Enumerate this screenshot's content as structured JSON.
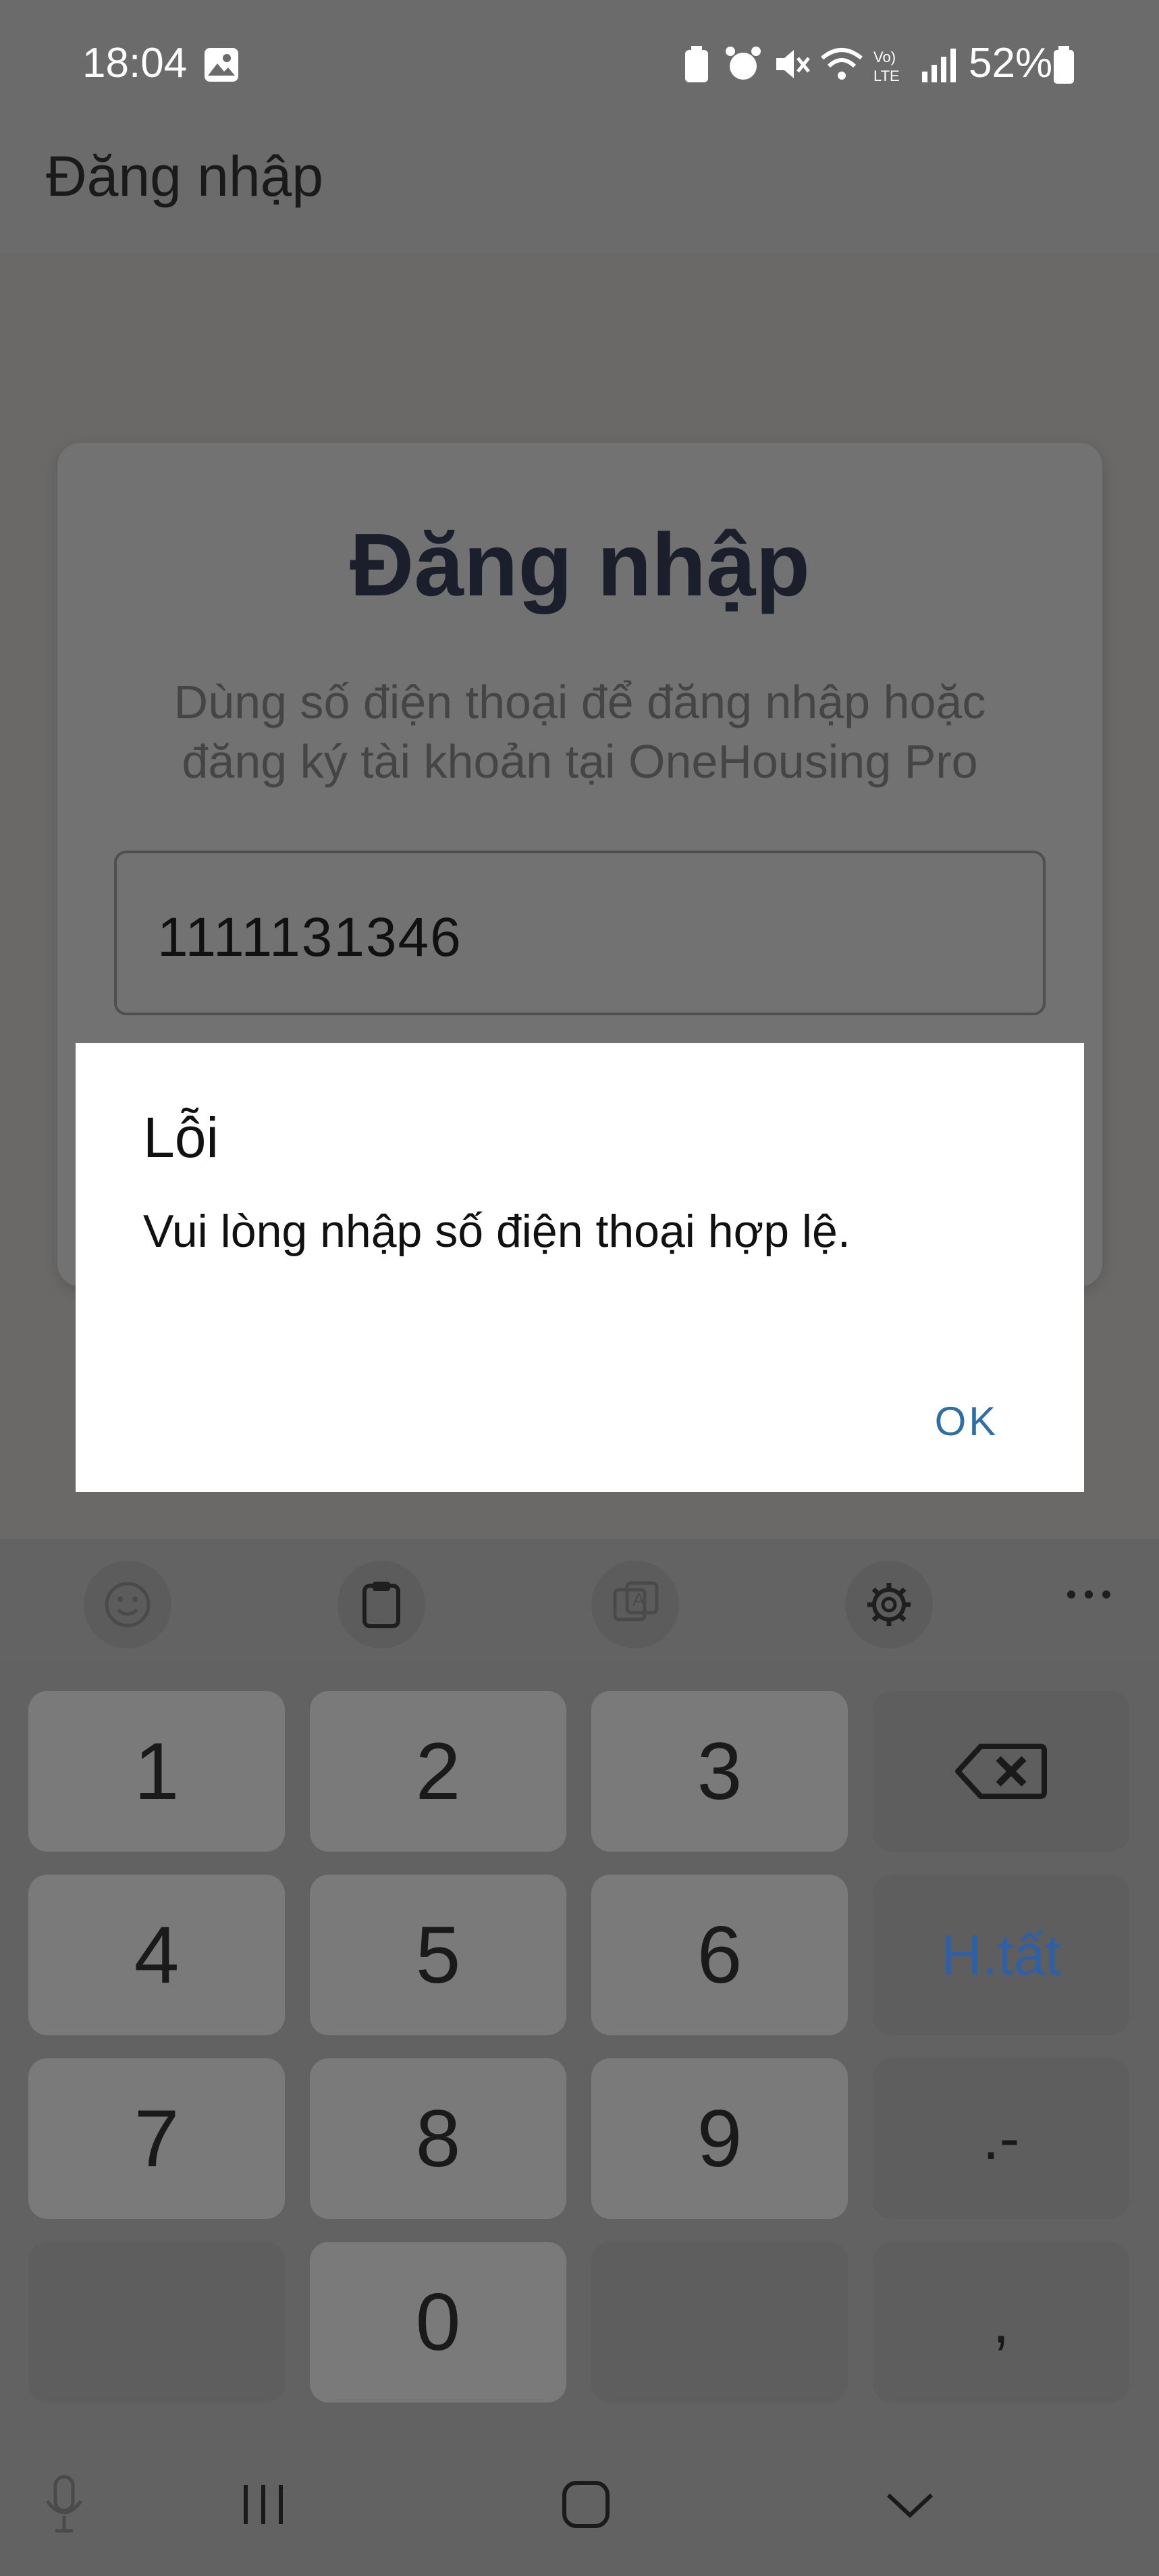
{
  "status_bar": {
    "time": "18:04",
    "battery": "52%"
  },
  "app_bar": {
    "title": "Đăng nhập"
  },
  "login_card": {
    "title": "Đăng nhập",
    "subtitle_line1": "Dùng số điện thoại để đăng nhập hoặc",
    "subtitle_line2": "đăng ký tài khoản tại OneHousing Pro",
    "phone_value": "1111131346"
  },
  "dialog": {
    "title": "Lỗi",
    "message": "Vui lòng nhập số điện thoại hợp lệ.",
    "ok_label": "OK"
  },
  "keyboard": {
    "toolbar_icons": [
      "emoji-icon",
      "clipboard-icon",
      "text-style-icon",
      "settings-icon",
      "more-icon"
    ],
    "keys": {
      "k1": "1",
      "k2": "2",
      "k3": "3",
      "k4": "4",
      "k5": "5",
      "k6": "6",
      "done": "H.tất",
      "k7": "7",
      "k8": "8",
      "k9": "9",
      "dot_dash": ".-",
      "k0": "0",
      "comma": ","
    }
  },
  "nav_bar": {
    "icons": [
      "mic-icon",
      "recent-apps-icon",
      "home-icon",
      "hide-keyboard-icon"
    ]
  },
  "colors": {
    "dialog_button": "#2f6fa7",
    "scrim": "#6b6b6b",
    "done_key": "#2f5fa5"
  }
}
